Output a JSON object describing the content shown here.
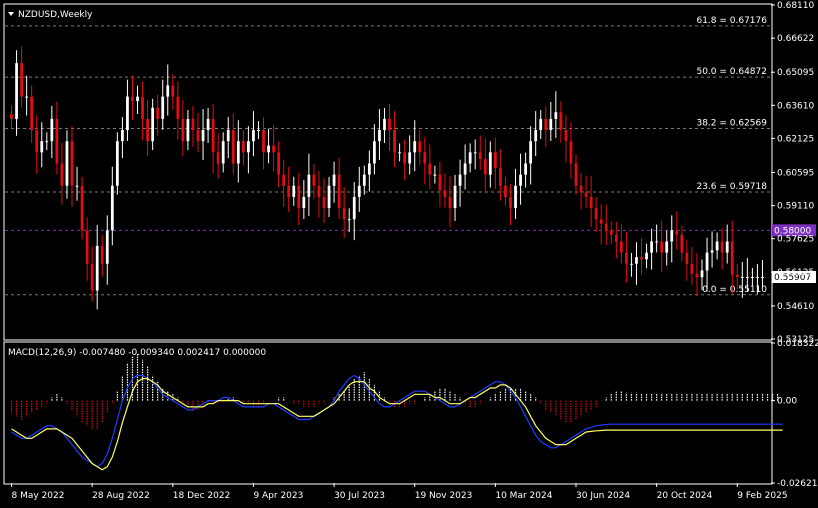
{
  "chart_data": [
    {
      "type": "candlestick",
      "title": "NZDUSD,Weekly",
      "ylim": [
        0.53125,
        0.6811
      ],
      "y_ticks": [
        {
          "value": 0.6811,
          "label": "0.68110"
        },
        {
          "value": 0.66622,
          "label": "0.66622"
        },
        {
          "value": 0.65095,
          "label": "0.65095"
        },
        {
          "value": 0.6361,
          "label": "0.63610"
        },
        {
          "value": 0.62125,
          "label": "0.62125"
        },
        {
          "value": 0.60595,
          "label": "0.60595"
        },
        {
          "value": 0.5911,
          "label": "0.59110"
        },
        {
          "value": 0.57625,
          "label": "0.57625"
        },
        {
          "value": 0.56125,
          "label": "0.56125"
        },
        {
          "value": 0.5461,
          "label": "0.54610"
        },
        {
          "value": 0.53125,
          "label": "0.53125"
        }
      ],
      "x_ticks": [
        {
          "index": 0,
          "label": "8 May 2022"
        },
        {
          "index": 16,
          "label": "28 Aug 2022"
        },
        {
          "index": 32,
          "label": "18 Dec 2022"
        },
        {
          "index": 48,
          "label": "9 Apr 2023"
        },
        {
          "index": 64,
          "label": "30 Jul 2023"
        },
        {
          "index": 80,
          "label": "19 Nov 2023"
        },
        {
          "index": 96,
          "label": "10 Mar 2024"
        },
        {
          "index": 112,
          "label": "30 Jun 2024"
        },
        {
          "index": 128,
          "label": "20 Oct 2024"
        },
        {
          "index": 144,
          "label": "9 Feb 2025"
        }
      ],
      "fib_levels": [
        {
          "value": 0.67176,
          "label": "61.8 = 0.67176"
        },
        {
          "value": 0.64872,
          "label": "50.0 = 0.64872"
        },
        {
          "value": 0.62569,
          "label": "38.2 = 0.62569"
        },
        {
          "value": 0.59718,
          "label": "23.6 = 0.59718"
        },
        {
          "value": 0.5511,
          "label": "0.0 = 0.55110"
        }
      ],
      "hline": {
        "value": 0.58,
        "label": "0.58000",
        "color": "#7b2fbf"
      },
      "current_price": {
        "value": 0.55907,
        "label": "0.55907"
      },
      "colors": {
        "bull": "#ffffff",
        "bear": "#e01010",
        "grid": "#7a7a7a",
        "axis": "#ffffff"
      },
      "closes": [
        0.63,
        0.655,
        0.64,
        0.64,
        0.625,
        0.615,
        0.62,
        0.62,
        0.63,
        0.61,
        0.6,
        0.62,
        0.6,
        0.6,
        0.58,
        0.565,
        0.553,
        0.573,
        0.565,
        0.58,
        0.6,
        0.62,
        0.625,
        0.64,
        0.638,
        0.64,
        0.63,
        0.62,
        0.635,
        0.63,
        0.64,
        0.645,
        0.64,
        0.63,
        0.62,
        0.63,
        0.625,
        0.62,
        0.625,
        0.63,
        0.615,
        0.61,
        0.62,
        0.625,
        0.61,
        0.62,
        0.615,
        0.62,
        0.625,
        0.625,
        0.615,
        0.618,
        0.615,
        0.605,
        0.6,
        0.595,
        0.6,
        0.59,
        0.595,
        0.605,
        0.6,
        0.595,
        0.59,
        0.6,
        0.605,
        0.59,
        0.585,
        0.585,
        0.595,
        0.6,
        0.605,
        0.61,
        0.62,
        0.625,
        0.63,
        0.625,
        0.615,
        0.615,
        0.61,
        0.615,
        0.62,
        0.615,
        0.61,
        0.605,
        0.605,
        0.598,
        0.595,
        0.59,
        0.6,
        0.605,
        0.61,
        0.615,
        0.615,
        0.612,
        0.605,
        0.615,
        0.608,
        0.6,
        0.595,
        0.59,
        0.6,
        0.605,
        0.61,
        0.62,
        0.625,
        0.63,
        0.625,
        0.63,
        0.633,
        0.625,
        0.62,
        0.61,
        0.6,
        0.597,
        0.595,
        0.59,
        0.585,
        0.583,
        0.58,
        0.578,
        0.575,
        0.57,
        0.565,
        0.565,
        0.568,
        0.567,
        0.57,
        0.575,
        0.575,
        0.57,
        0.575,
        0.58,
        0.578,
        0.57,
        0.565,
        0.5605,
        0.559,
        0.562,
        0.57,
        0.571,
        0.575,
        0.57,
        0.575,
        0.56,
        0.5591,
        0.5591,
        0.5591,
        0.5591,
        0.5591,
        0.5591
      ],
      "macd": {
        "label": "MACD(12,26,9) -0.007480 -0.009340 0.002417 0.000000",
        "ylim": [
          -0.026212,
          0.018322
        ],
        "y_ticks": [
          {
            "value": 0.018322,
            "label": "0.018322"
          },
          {
            "value": 0.0,
            "label": "0.00"
          },
          {
            "value": -0.026212,
            "label": "-0.026212"
          }
        ],
        "histogram": [
          -0.004,
          -0.005,
          -0.006,
          -0.005,
          -0.004,
          -0.003,
          -0.002,
          -0.001,
          0.001,
          0.002,
          0.001,
          -0.001,
          -0.003,
          -0.005,
          -0.007,
          -0.008,
          -0.009,
          -0.009,
          -0.007,
          -0.004,
          -0.001,
          0.003,
          0.008,
          0.012,
          0.014,
          0.015,
          0.013,
          0.011,
          0.008,
          0.006,
          0.004,
          0.003,
          0.002,
          0.001,
          -0.001,
          -0.002,
          -0.003,
          -0.003,
          -0.002,
          -0.001,
          -0.001,
          -0.001,
          0.0,
          0.001,
          0.001,
          0.0,
          -0.001,
          -0.001,
          -0.002,
          -0.002,
          -0.001,
          0.0,
          0.0,
          0.001,
          0.001,
          0.0,
          -0.001,
          -0.001,
          -0.002,
          -0.002,
          -0.002,
          -0.001,
          -0.001,
          0.0,
          0.001,
          0.002,
          0.003,
          0.005,
          0.007,
          0.008,
          0.009,
          0.007,
          0.005,
          0.003,
          0.001,
          -0.001,
          -0.002,
          -0.002,
          -0.002,
          -0.001,
          -0.001,
          0.0,
          0.001,
          0.002,
          0.003,
          0.004,
          0.004,
          0.003,
          0.002,
          0.001,
          -0.001,
          -0.002,
          -0.002,
          -0.001,
          0.0,
          0.001,
          0.002,
          0.003,
          0.004,
          0.004,
          0.004,
          0.004,
          0.003,
          0.002,
          0.001,
          -0.001,
          -0.003,
          -0.004,
          -0.005,
          -0.006,
          -0.007,
          -0.007,
          -0.006,
          -0.005,
          -0.004,
          -0.003,
          -0.002,
          0.0,
          0.001,
          0.002,
          0.003,
          0.003,
          0.0025,
          0.0025,
          0.0025,
          0.0024,
          0.0024,
          0.0024,
          0.0024,
          0.0024,
          0.0024,
          0.0024,
          0.0024,
          0.0024,
          0.0024,
          0.0024,
          0.0024,
          0.0024,
          0.0024,
          0.0024,
          0.0024,
          0.0024,
          0.0024,
          0.0024,
          0.0024,
          0.0024,
          0.0024,
          0.0024,
          0.0024,
          0.0024,
          0.0024,
          0.0024,
          0.0024
        ],
        "macd_line": [
          -0.01,
          -0.011,
          -0.012,
          -0.012,
          -0.011,
          -0.01,
          -0.009,
          -0.008,
          -0.008,
          -0.009,
          -0.01,
          -0.012,
          -0.014,
          -0.016,
          -0.018,
          -0.019,
          -0.02,
          -0.021,
          -0.02,
          -0.017,
          -0.012,
          -0.006,
          0.0,
          0.004,
          0.007,
          0.008,
          0.008,
          0.007,
          0.006,
          0.004,
          0.002,
          0.001,
          0.0,
          -0.001,
          -0.002,
          -0.003,
          -0.003,
          -0.002,
          -0.001,
          0.0,
          0.0,
          0.0,
          0.001,
          0.001,
          0.0,
          -0.001,
          -0.002,
          -0.002,
          -0.002,
          -0.002,
          -0.002,
          -0.001,
          -0.001,
          -0.002,
          -0.003,
          -0.004,
          -0.005,
          -0.006,
          -0.006,
          -0.006,
          -0.005,
          -0.004,
          -0.003,
          -0.002,
          0.0,
          0.003,
          0.005,
          0.007,
          0.008,
          0.007,
          0.005,
          0.003,
          0.001,
          -0.001,
          -0.002,
          -0.002,
          -0.001,
          0.0,
          0.001,
          0.002,
          0.003,
          0.003,
          0.003,
          0.002,
          0.001,
          0.0,
          -0.001,
          -0.002,
          -0.002,
          -0.001,
          0.0,
          0.001,
          0.002,
          0.003,
          0.004,
          0.005,
          0.006,
          0.006,
          0.005,
          0.003,
          0.001,
          -0.002,
          -0.005,
          -0.008,
          -0.011,
          -0.013,
          -0.014,
          -0.015,
          -0.015,
          -0.014,
          -0.013,
          -0.012,
          -0.011,
          -0.01,
          -0.009,
          -0.0085,
          -0.008,
          -0.0078,
          -0.0076,
          -0.0075,
          -0.0075,
          -0.0075,
          -0.0075,
          -0.0075,
          -0.0075,
          -0.0075,
          -0.0075,
          -0.0075,
          -0.0075,
          -0.0075,
          -0.0075,
          -0.0075,
          -0.0075,
          -0.0075,
          -0.0075,
          -0.0075,
          -0.0075,
          -0.0075,
          -0.0075,
          -0.0075,
          -0.0075,
          -0.0075,
          -0.0075,
          -0.0075,
          -0.0075,
          -0.0075,
          -0.0075,
          -0.0075,
          -0.0075,
          -0.0075,
          -0.0075,
          -0.0075,
          -0.0075,
          -0.0075
        ],
        "signal_line": [
          -0.009,
          -0.01,
          -0.011,
          -0.012,
          -0.012,
          -0.011,
          -0.01,
          -0.009,
          -0.009,
          -0.009,
          -0.01,
          -0.011,
          -0.012,
          -0.014,
          -0.016,
          -0.018,
          -0.02,
          -0.021,
          -0.022,
          -0.021,
          -0.018,
          -0.013,
          -0.007,
          -0.002,
          0.003,
          0.006,
          0.007,
          0.007,
          0.006,
          0.005,
          0.003,
          0.002,
          0.001,
          0.0,
          -0.001,
          -0.002,
          -0.002,
          -0.002,
          -0.002,
          -0.001,
          -0.001,
          0.0,
          0.0,
          0.0,
          0.0,
          0.0,
          -0.001,
          -0.001,
          -0.001,
          -0.001,
          -0.001,
          -0.001,
          -0.001,
          -0.001,
          -0.002,
          -0.003,
          -0.004,
          -0.005,
          -0.005,
          -0.005,
          -0.005,
          -0.004,
          -0.003,
          -0.002,
          -0.001,
          0.001,
          0.003,
          0.005,
          0.006,
          0.006,
          0.006,
          0.004,
          0.003,
          0.001,
          0.0,
          -0.001,
          -0.001,
          -0.001,
          0.0,
          0.001,
          0.002,
          0.002,
          0.002,
          0.002,
          0.001,
          0.001,
          0.0,
          -0.001,
          -0.001,
          -0.001,
          0.0,
          0.001,
          0.001,
          0.002,
          0.003,
          0.004,
          0.004,
          0.005,
          0.005,
          0.004,
          0.002,
          0.0,
          -0.002,
          -0.005,
          -0.008,
          -0.01,
          -0.012,
          -0.013,
          -0.014,
          -0.014,
          -0.014,
          -0.013,
          -0.012,
          -0.011,
          -0.01,
          -0.0098,
          -0.0096,
          -0.0095,
          -0.0094,
          -0.0094,
          -0.0094,
          -0.0094,
          -0.0094,
          -0.0094,
          -0.0094,
          -0.0094,
          -0.0094,
          -0.0094,
          -0.0094,
          -0.0094,
          -0.0094,
          -0.0094,
          -0.0094,
          -0.0094,
          -0.0094,
          -0.0094,
          -0.0094,
          -0.0094,
          -0.0094,
          -0.0094,
          -0.0094,
          -0.0094,
          -0.0094,
          -0.0094,
          -0.0094,
          -0.0094,
          -0.0094,
          -0.0094,
          -0.0094,
          -0.0094,
          -0.0094,
          -0.0094,
          -0.0094,
          -0.0094
        ],
        "colors": {
          "hist_pos": "#ffffff",
          "hist_neg": "#e01010",
          "macd_line": "#1e3cff",
          "signal_line": "#ffff66"
        }
      }
    }
  ]
}
